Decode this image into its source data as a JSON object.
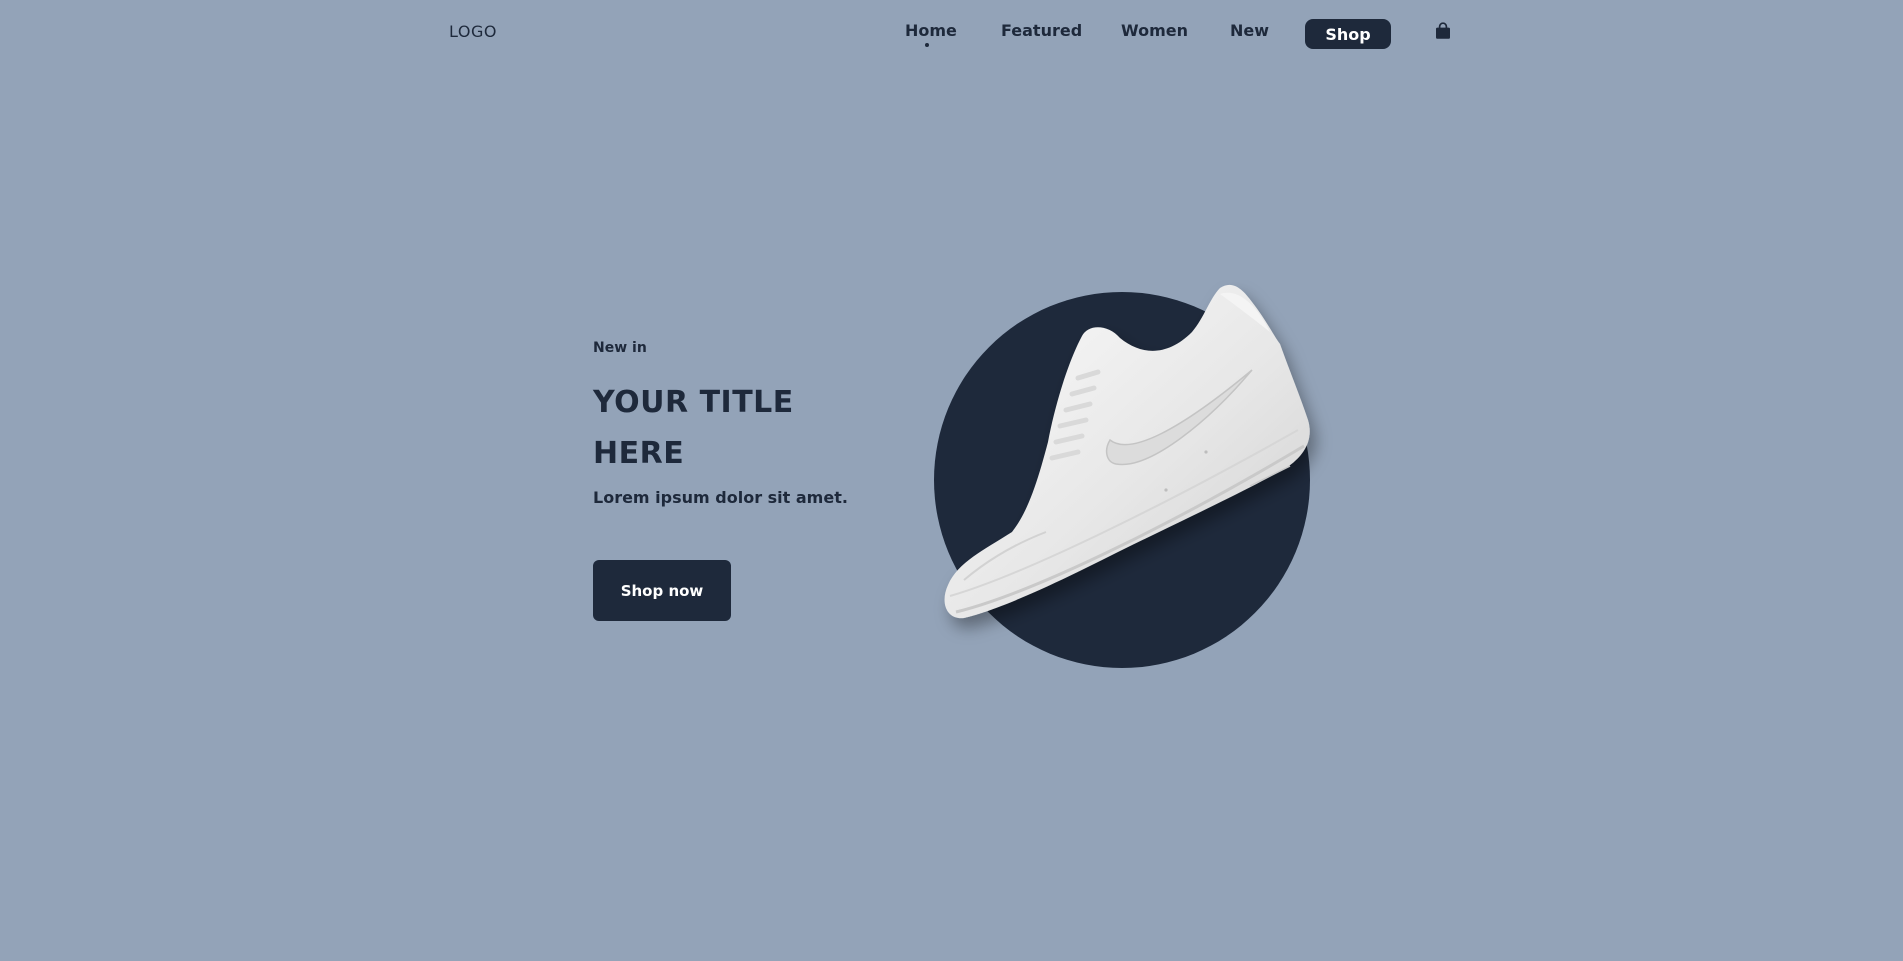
{
  "header": {
    "logo": "LOGO",
    "nav": {
      "home": "Home",
      "featured": "Featured",
      "women": "Women",
      "new": "New",
      "shop": "Shop"
    },
    "active": "Home",
    "cart_icon": "shopping-bag-icon"
  },
  "hero": {
    "eyebrow": "New in",
    "title": "YOUR TITLE HERE",
    "subtitle": "Lorem ipsum dolor sit amet.",
    "cta": "Shop now",
    "image": "white-sneaker"
  },
  "colors": {
    "background": "#93a3b8",
    "dark": "#1e293b",
    "light": "#ffffff"
  }
}
